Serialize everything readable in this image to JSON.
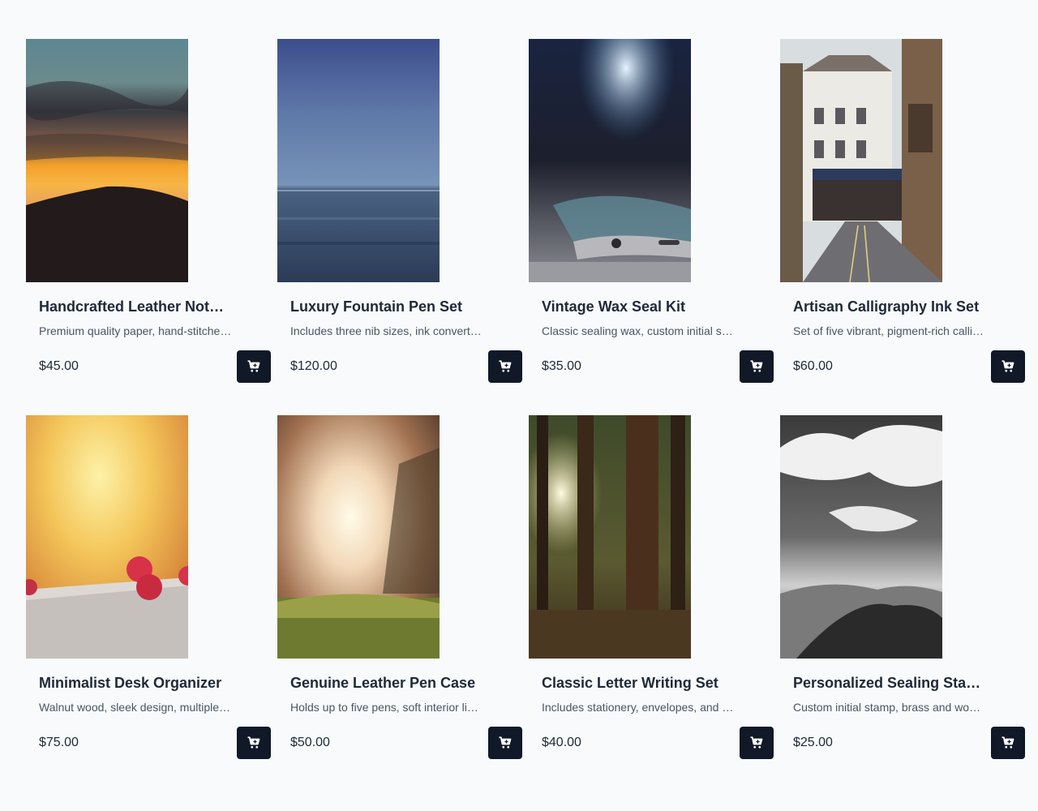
{
  "products": [
    {
      "title": "Handcrafted Leather Notebook",
      "desc": "Premium quality paper, hand-stitched leather cover",
      "price": "$45.00",
      "image": "sunset-mountain",
      "cart_icon": "cart-icon"
    },
    {
      "title": "Luxury Fountain Pen Set",
      "desc": "Includes three nib sizes, ink converter and case",
      "price": "$120.00",
      "image": "ocean-horizon",
      "cart_icon": "cart-icon"
    },
    {
      "title": "Vintage Wax Seal Kit",
      "desc": "Classic sealing wax, custom initial stamp",
      "price": "$35.00",
      "image": "phone-closeup",
      "cart_icon": "cart-icon"
    },
    {
      "title": "Artisan Calligraphy Ink Set",
      "desc": "Set of five vibrant, pigment-rich calligraphy inks",
      "price": "$60.00",
      "image": "city-street",
      "cart_icon": "cart-icon"
    },
    {
      "title": "Minimalist Desk Organizer",
      "desc": "Walnut wood, sleek design, multiple compartments",
      "price": "$75.00",
      "image": "raspberries",
      "cart_icon": "cart-icon"
    },
    {
      "title": "Genuine Leather Pen Case",
      "desc": "Holds up to five pens, soft interior lining",
      "price": "$50.00",
      "image": "sunlit-meadow",
      "cart_icon": "cart-icon"
    },
    {
      "title": "Classic Letter Writing Set",
      "desc": "Includes stationery, envelopes, and a fine pen",
      "price": "$40.00",
      "image": "forest-sunbeam",
      "cart_icon": "cart-icon"
    },
    {
      "title": "Personalized Sealing Stamp",
      "desc": "Custom initial stamp, brass and wood handle",
      "price": "$25.00",
      "image": "bw-mountains",
      "cart_icon": "cart-icon"
    }
  ],
  "colors": {
    "background": "#f8fafc",
    "button": "#111827",
    "title": "#1f2937",
    "description": "#4b5563"
  }
}
